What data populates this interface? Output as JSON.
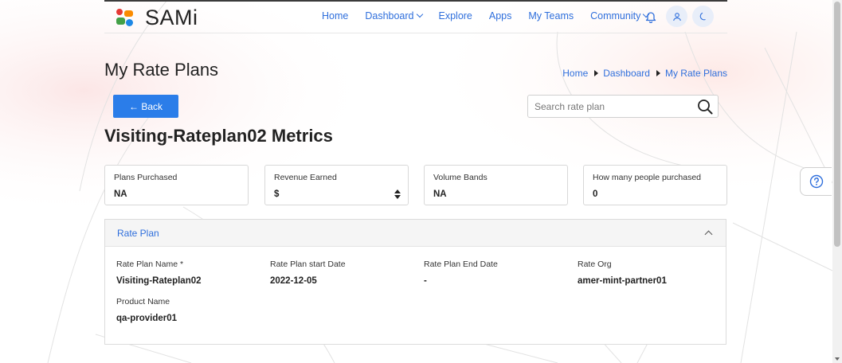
{
  "brand": {
    "name": "SAMi",
    "logo_icon": "sami-logo-icon"
  },
  "nav": {
    "links": [
      {
        "label": "Home",
        "has_dropdown": false
      },
      {
        "label": "Dashboard",
        "has_dropdown": true
      },
      {
        "label": "Explore",
        "has_dropdown": false
      },
      {
        "label": "Apps",
        "has_dropdown": false
      },
      {
        "label": "My Teams",
        "has_dropdown": false
      },
      {
        "label": "Community",
        "has_dropdown": true
      }
    ],
    "icons": [
      "bell-icon",
      "user-icon",
      "moon-icon"
    ]
  },
  "page": {
    "title": "My Rate Plans"
  },
  "breadcrumb": {
    "items": [
      "Home",
      "Dashboard",
      "My Rate Plans"
    ]
  },
  "back_button": {
    "label": "← Back"
  },
  "search": {
    "placeholder": "Search rate plan",
    "value": ""
  },
  "metrics": {
    "title": "Visiting-Rateplan02 Metrics",
    "cards": [
      {
        "label": "Plans Purchased",
        "value": "NA"
      },
      {
        "label": "Revenue Earned",
        "value": "$"
      },
      {
        "label": "Volume Bands",
        "value": "NA"
      },
      {
        "label": "How many people purchased",
        "value": "0"
      }
    ]
  },
  "rate_plan": {
    "section_title": "Rate Plan",
    "fields": [
      {
        "label": "Rate Plan Name *",
        "value": "Visiting-Rateplan02"
      },
      {
        "label": "Rate Plan start Date",
        "value": "2022-12-05"
      },
      {
        "label": "Rate Plan End Date",
        "value": "-"
      },
      {
        "label": "Rate Org",
        "value": "amer-mint-partner01"
      },
      {
        "label": "Product Name",
        "value": "qa-provider01"
      }
    ]
  },
  "colors": {
    "accent": "#2b7de9",
    "link": "#2f6fdc"
  }
}
